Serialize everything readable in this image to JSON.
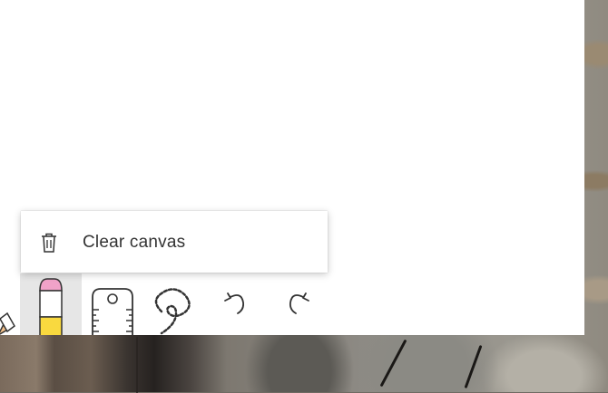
{
  "flyout": {
    "items": [
      {
        "label": "Clear canvas",
        "icon": "trash-icon"
      }
    ]
  },
  "toolbar": {
    "tools": [
      {
        "icon": "ballpoint-pen-icon"
      },
      {
        "icon": "eraser-icon",
        "selected": true
      },
      {
        "icon": "ruler-icon"
      },
      {
        "icon": "lasso-select-icon"
      },
      {
        "icon": "undo-icon"
      },
      {
        "icon": "redo-icon"
      }
    ]
  },
  "colors": {
    "eraser_pink": "#f0a2c8",
    "eraser_yellow": "#f9d93f",
    "selected_bg": "#e6e6e6"
  }
}
